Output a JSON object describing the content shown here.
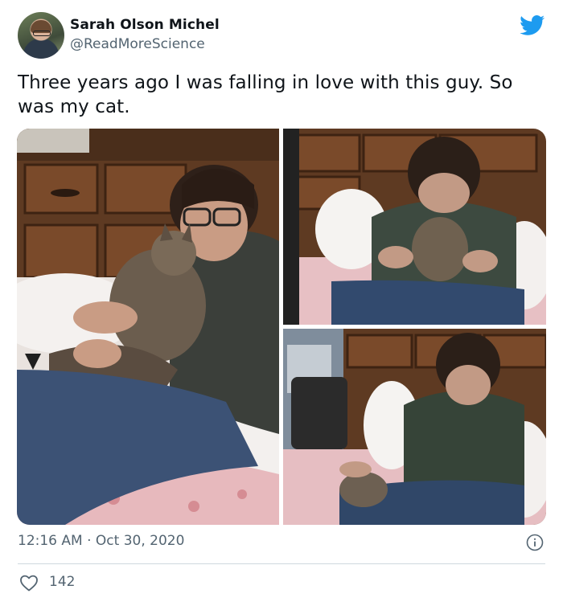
{
  "author": {
    "display_name": "Sarah Olson Michel",
    "handle": "@ReadMoreScience"
  },
  "tweet": {
    "text": "Three years ago I was falling in love with this guy. So was my cat.",
    "timestamp": "12:16 AM · Oct 30, 2020",
    "like_count": "142"
  },
  "icons": {
    "brand": "twitter-bird-icon",
    "info": "info-icon",
    "like": "heart-icon"
  },
  "colors": {
    "brand_blue": "#1d9bf0",
    "secondary_text": "#536471",
    "divider": "#cfd9de"
  }
}
